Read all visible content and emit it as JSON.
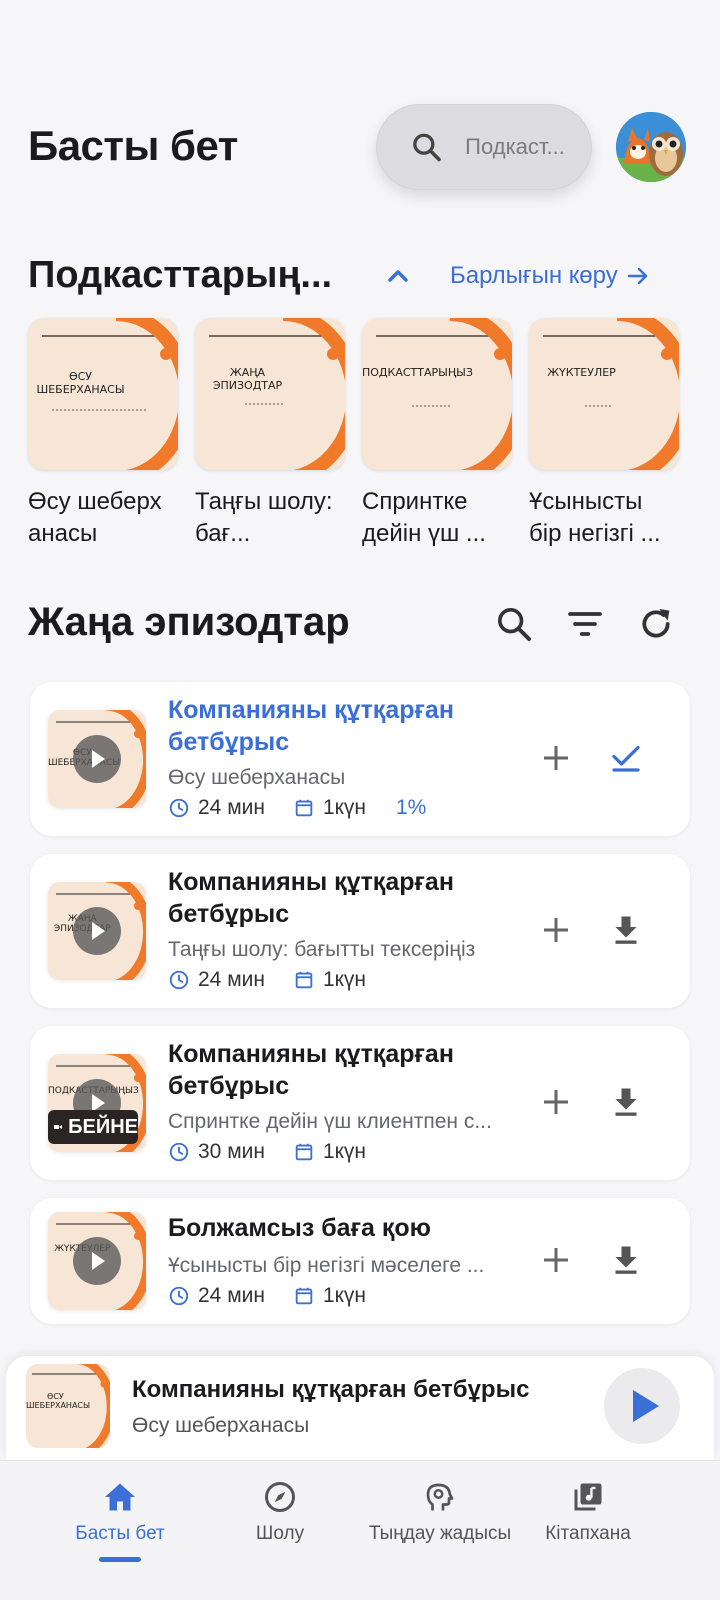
{
  "header": {
    "title": "Басты бет",
    "search_placeholder": "Подкаст..."
  },
  "subscriptions": {
    "title": "Подкасттарың...",
    "see_all": "Барлығын көру",
    "items": [
      {
        "art_text": "ӨСУ ШЕБЕРХАНАСЫ",
        "name": "Өсу шеберх анасы"
      },
      {
        "art_text": "ЖАҢА ЭПИЗОДТАР",
        "name": "Таңғы шолу: бағ..."
      },
      {
        "art_text": "ПОДКАСТТАРЫҢЫЗ",
        "name": "Спринтке дейін үш ..."
      },
      {
        "art_text": "ЖҮКТЕУЛЕР",
        "name": "Ұсынысты бір негізгі ..."
      }
    ]
  },
  "episodes": {
    "title": "Жаңа эпизодтар",
    "items": [
      {
        "art_text": "ӨСУ ШЕБЕРХАНАСЫ",
        "title": "Компанияны құтқарған бетбұрыс",
        "podcast": "Өсу шеберханасы",
        "duration": "24 мин",
        "date": "1күн",
        "progress": "1%",
        "action": "check"
      },
      {
        "art_text": "ЖАҢА ЭПИЗОДТАР",
        "title": "Компанияны құтқарған бетбұрыс",
        "podcast": "Таңғы шолу: бағытты тексеріңіз",
        "duration": "24 мин",
        "date": "1күн",
        "action": "download"
      },
      {
        "art_text": "ПОДКАСТТАРЫҢЫЗ",
        "title": "Компанияны құтқарған бетбұрыс",
        "podcast": "Спринтке дейін үш клиентпен с...",
        "duration": "30 мин",
        "date": "1күн",
        "action": "download",
        "badge": "БЕЙНЕ"
      },
      {
        "art_text": "ЖҮКТЕУЛЕР",
        "title": "Болжамсыз баға қою",
        "podcast": "Ұсынысты бір негізгі мәселеге ...",
        "duration": "24 мин",
        "date": "1күн",
        "action": "download"
      }
    ]
  },
  "mini_player": {
    "art_text": "ӨСУ ШЕБЕРХАНАСЫ",
    "title": "Компанияны құтқарған бетбұрыс",
    "podcast": "Өсу шеберханасы"
  },
  "nav": {
    "items": [
      {
        "label": "Басты бет",
        "icon": "home-icon",
        "active": true
      },
      {
        "label": "Шолу",
        "icon": "compass-icon"
      },
      {
        "label": "Тыңдау жадысы",
        "icon": "head-icon"
      },
      {
        "label": "Кітапхана",
        "icon": "library-icon"
      }
    ]
  },
  "colors": {
    "accent": "#3a6fd8",
    "art_bg": "#f7e6d5",
    "art_orange": "#f07a2a"
  }
}
